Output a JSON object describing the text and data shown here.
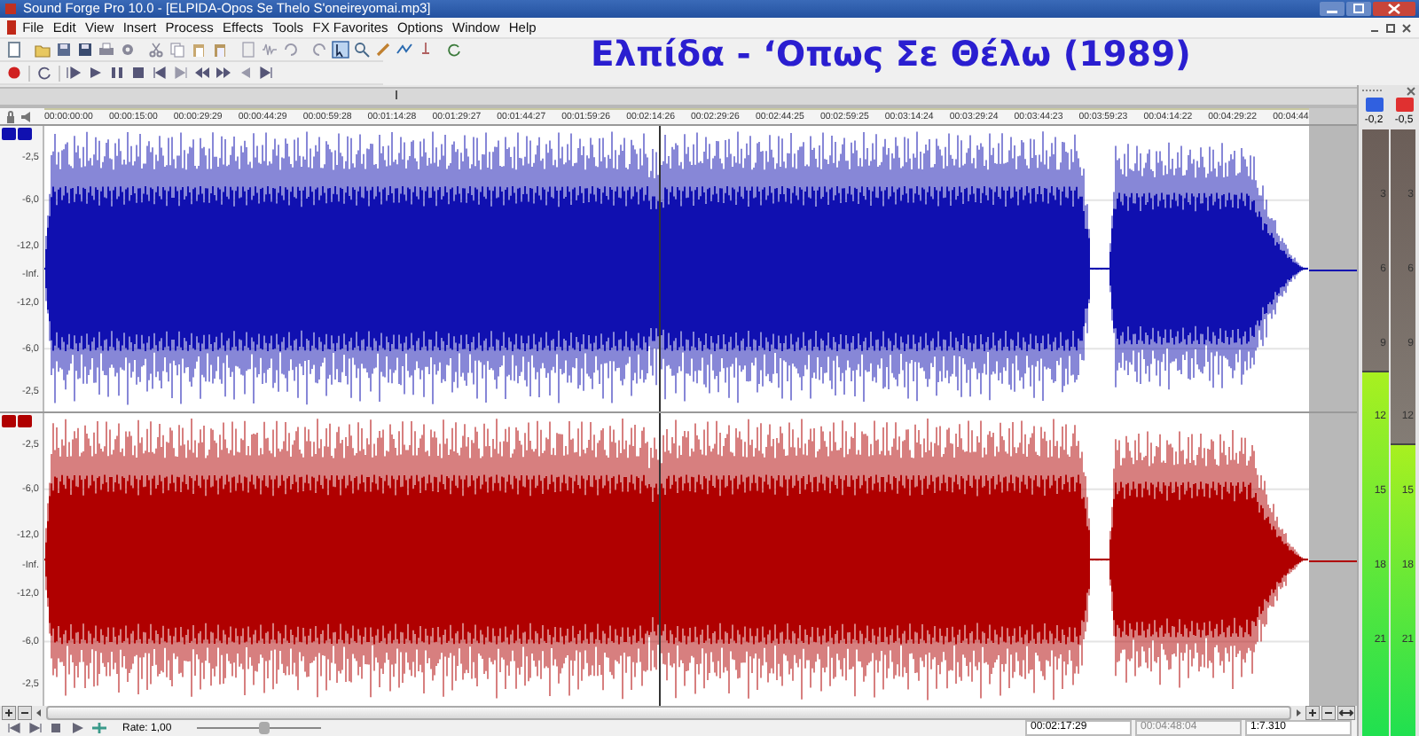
{
  "window": {
    "title": "Sound Forge Pro 10.0 - [ELPIDA-Opos Se Thelo S'oneireyomai.mp3]"
  },
  "menu": [
    "File",
    "Edit",
    "View",
    "Insert",
    "Process",
    "Effects",
    "Tools",
    "FX Favorites",
    "Options",
    "Window",
    "Help"
  ],
  "overlay_title": "Ελπίδα - ‘Οπως Σε Θέλω (1989)",
  "ruler": [
    "00:00:00:00",
    "00:00:15:00",
    "00:00:29:29",
    "00:00:44:29",
    "00:00:59:28",
    "00:01:14:28",
    "00:01:29:27",
    "00:01:44:27",
    "00:01:59:26",
    "00:02:14:26",
    "00:02:29:26",
    "00:02:44:25",
    "00:02:59:25",
    "00:03:14:24",
    "00:03:29:24",
    "00:03:44:23",
    "00:03:59:23",
    "00:04:14:22",
    "00:04:29:22",
    "00:04:44"
  ],
  "channels": [
    {
      "color": "#1010b0",
      "scale": [
        "-2,5",
        "-6,0",
        "-12,0",
        "-Inf.",
        "-12,0",
        "-6,0",
        "-2,5"
      ]
    },
    {
      "color": "#b00000",
      "scale": [
        "-2,5",
        "-6,0",
        "-12,0",
        "-Inf.",
        "-12,0",
        "-6,0",
        "-2,5"
      ]
    }
  ],
  "meters": [
    {
      "color": "#3060e0",
      "peak": "-0,2",
      "level": 0.6,
      "scale": [
        "3",
        "6",
        "9",
        "12",
        "15",
        "18",
        "21"
      ]
    },
    {
      "color": "#e03030",
      "peak": "-0,5",
      "level": 0.48,
      "scale": [
        "3",
        "6",
        "9",
        "12",
        "15",
        "18",
        "21"
      ]
    }
  ],
  "transport": {
    "rate": "Rate: 1,00",
    "rate_slider": {
      "level": 0.55
    }
  },
  "status_bar": {
    "position": "00:02:17:29",
    "length": "00:04:48:04",
    "zoom": "1:7.310"
  }
}
